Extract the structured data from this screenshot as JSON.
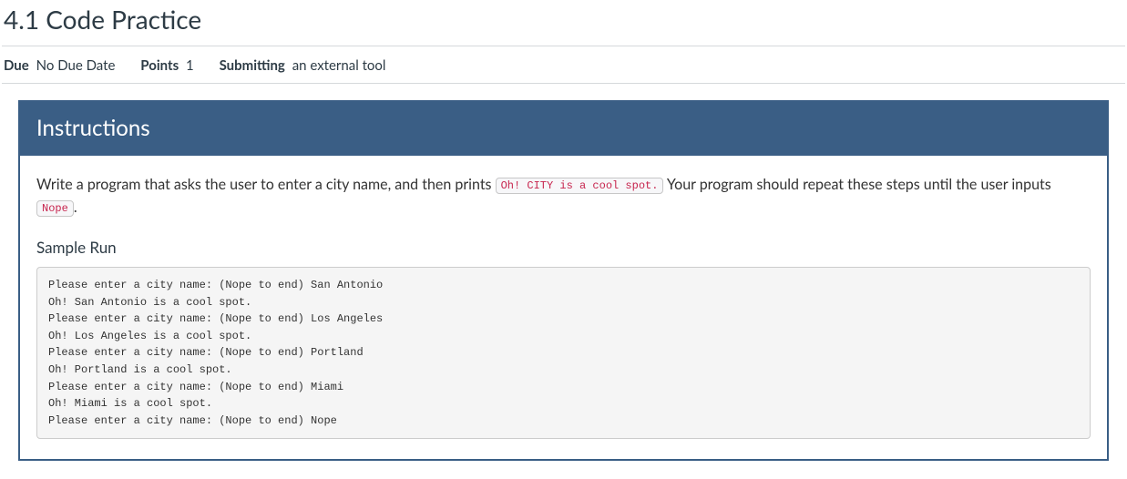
{
  "header": {
    "title": "4.1 Code Practice"
  },
  "meta": {
    "due_label": "Due",
    "due_value": "No Due Date",
    "points_label": "Points",
    "points_value": "1",
    "submitting_label": "Submitting",
    "submitting_value": "an external tool"
  },
  "panel": {
    "title": "Instructions",
    "desc_pre": "Write a program that asks the user to enter a city name, and then prints ",
    "code1": "Oh! CITY is a cool spot.",
    "desc_mid": " Your program should repeat these steps until the user inputs ",
    "code2": "Nope",
    "desc_post": ".",
    "sample_label": "Sample Run",
    "sample_run": "Please enter a city name: (Nope to end) San Antonio\nOh! San Antonio is a cool spot.\nPlease enter a city name: (Nope to end) Los Angeles\nOh! Los Angeles is a cool spot.\nPlease enter a city name: (Nope to end) Portland\nOh! Portland is a cool spot.\nPlease enter a city name: (Nope to end) Miami\nOh! Miami is a cool spot.\nPlease enter a city name: (Nope to end) Nope"
  }
}
